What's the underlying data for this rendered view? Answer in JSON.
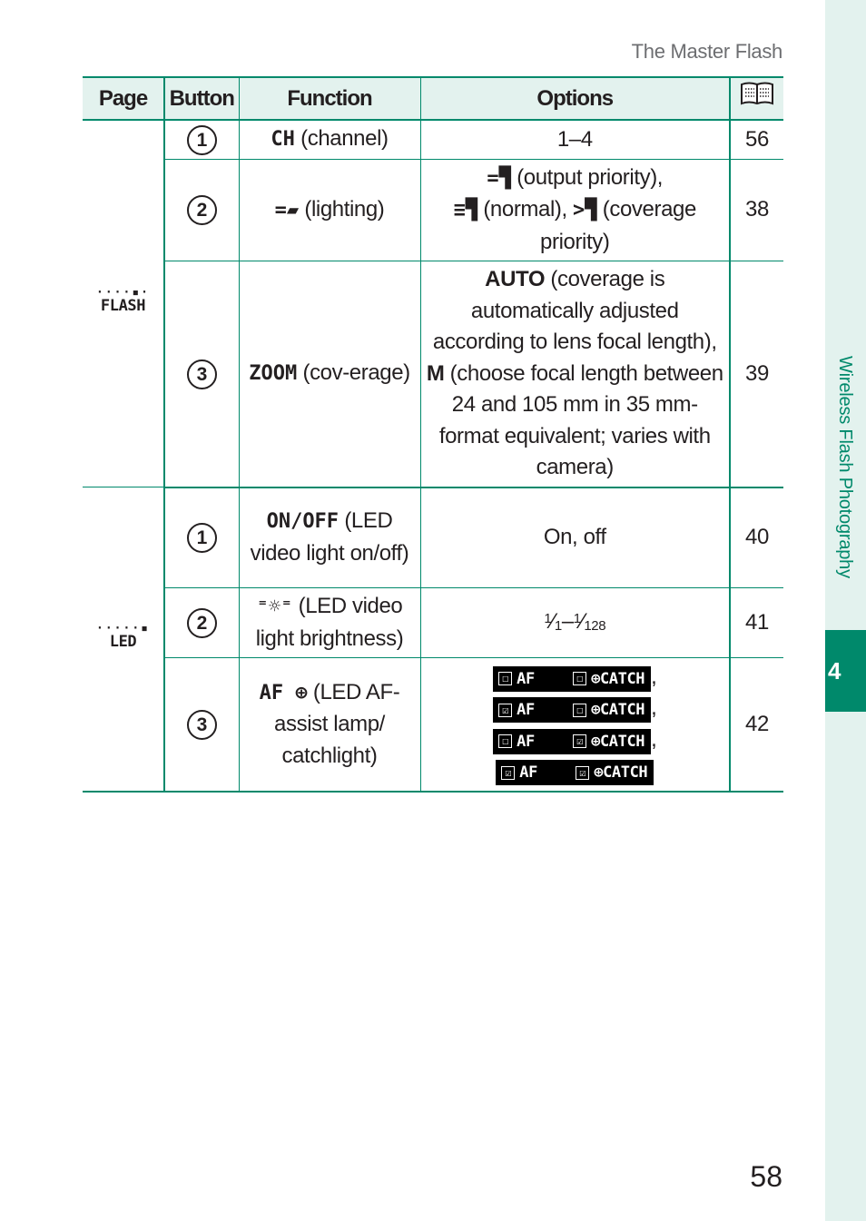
{
  "running_head": "The Master Flash",
  "side_tab": {
    "title": "Wireless Flash Photography",
    "chapter": "4"
  },
  "page_number": "58",
  "colors": {
    "accent": "#00896b",
    "tint": "#e3f2ee",
    "text": "#231f20",
    "muted": "#6d6e71"
  },
  "table": {
    "headers": {
      "page": "Page",
      "button": "Button",
      "function": "Function",
      "options": "Options",
      "ref_icon": "book-icon"
    },
    "groups": [
      {
        "page_icon": {
          "name": "flash-page-icon",
          "dots": "····▪·",
          "word": "FLASH"
        },
        "rows": [
          {
            "button": "1",
            "function_icon": "CH",
            "function_text": " (channel)",
            "options": "1–4",
            "ref": "56"
          },
          {
            "button": "2",
            "function_icon": "=▰",
            "function_text": " (lighting)",
            "options_parts": [
              {
                "icon": "=▜",
                "text": " (output priority),"
              },
              {
                "icon": "≡▜",
                "text": " (normal), "
              },
              {
                "icon": ">▜",
                "text": " (coverage priority)"
              }
            ],
            "ref": "38"
          },
          {
            "button": "3",
            "function_icon": "ZOOM",
            "function_text": " (cov-erage)",
            "options_auto": "AUTO",
            "options_auto_text": " (coverage is automatically adjusted according to lens focal length), ",
            "options_m": "M",
            "options_m_text": " (choose focal length between 24 and 105 mm in 35 mm-format equivalent; varies with camera)",
            "ref": "39"
          }
        ]
      },
      {
        "page_icon": {
          "name": "led-page-icon",
          "dots": "·····▪",
          "word": "LED"
        },
        "rows": [
          {
            "button": "1",
            "function_icon": "ON/OFF",
            "function_text": " (LED video light on/off)",
            "options": "On, off",
            "ref": "40"
          },
          {
            "button": "2",
            "function_icon": "⁼☼⁼",
            "function_text": " (LED video light brightness)",
            "options_frac": {
              "a_num": "1",
              "a_den": "1",
              "dash": "–",
              "b_num": "1",
              "b_den": "128"
            },
            "ref": "41"
          },
          {
            "button": "3",
            "function_icon": "AF ⊕",
            "function_text": " (LED AF-assist lamp/ catchlight)",
            "options_af": [
              {
                "af_check": "☐",
                "af_label": "AF",
                "catch_check": "☐",
                "catch_label": "⊕CATCH",
                "sep": ","
              },
              {
                "af_check": "☑",
                "af_label": "AF",
                "catch_check": "☐",
                "catch_label": "⊕CATCH",
                "sep": ","
              },
              {
                "af_check": "☐",
                "af_label": "AF",
                "catch_check": "☑",
                "catch_label": "⊕CATCH",
                "sep": ","
              },
              {
                "af_check": "☑",
                "af_label": "AF",
                "catch_check": "☑",
                "catch_label": "⊕CATCH",
                "sep": ""
              }
            ],
            "ref": "42"
          }
        ]
      }
    ]
  }
}
